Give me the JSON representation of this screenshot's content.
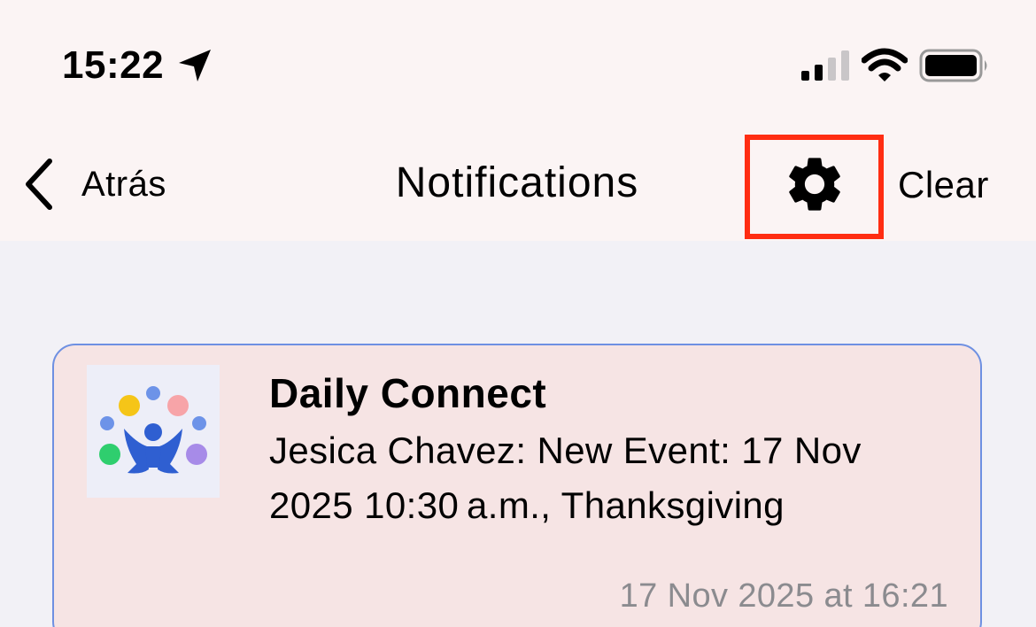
{
  "status_bar": {
    "time": "15:22",
    "location_icon": "location-arrow-icon",
    "signal_icon": "cellular-signal-icon",
    "wifi_icon": "wifi-icon",
    "battery_icon": "battery-icon"
  },
  "nav": {
    "back_label": "Atrás",
    "title": "Notifications",
    "settings_icon": "gear-icon",
    "clear_label": "Clear",
    "highlight_color": "#ff2d12"
  },
  "notifications": [
    {
      "app_icon": "daily-connect-logo",
      "title": "Daily Connect",
      "body": "Jesica Chavez: New Event: 17 Nov 2025 10:30 a.m., Thanksgiving",
      "time": "17 Nov 2025 at 16:21",
      "card_color": "#f6e4e4",
      "border_color": "#6e90e2"
    }
  ]
}
